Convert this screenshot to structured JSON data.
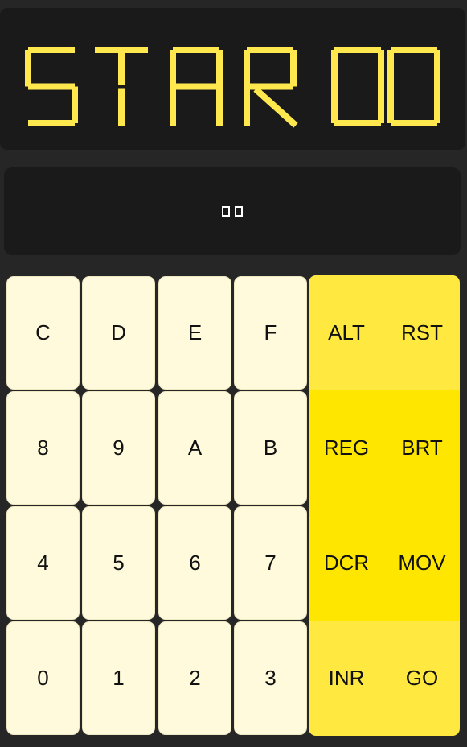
{
  "display": {
    "text": "STAR00",
    "color": "#ffe84d",
    "background": "#1a1a1a"
  },
  "entry": {
    "placeholder_glyphs": "two empty boxes"
  },
  "keypad": {
    "rows": [
      [
        "C",
        "D",
        "E",
        "F"
      ],
      [
        "8",
        "9",
        "A",
        "B"
      ],
      [
        "4",
        "5",
        "6",
        "7"
      ],
      [
        "0",
        "1",
        "2",
        "3"
      ]
    ],
    "key_color": "#fffadb"
  },
  "functions": {
    "rows": [
      [
        "ALT",
        "RST"
      ],
      [
        "REG",
        "BRT"
      ],
      [
        "DCR",
        "MOV"
      ],
      [
        "INR",
        "GO"
      ]
    ],
    "row_colors": [
      "#ffe840",
      "#ffe600",
      "#ffe600",
      "#ffe840"
    ]
  }
}
